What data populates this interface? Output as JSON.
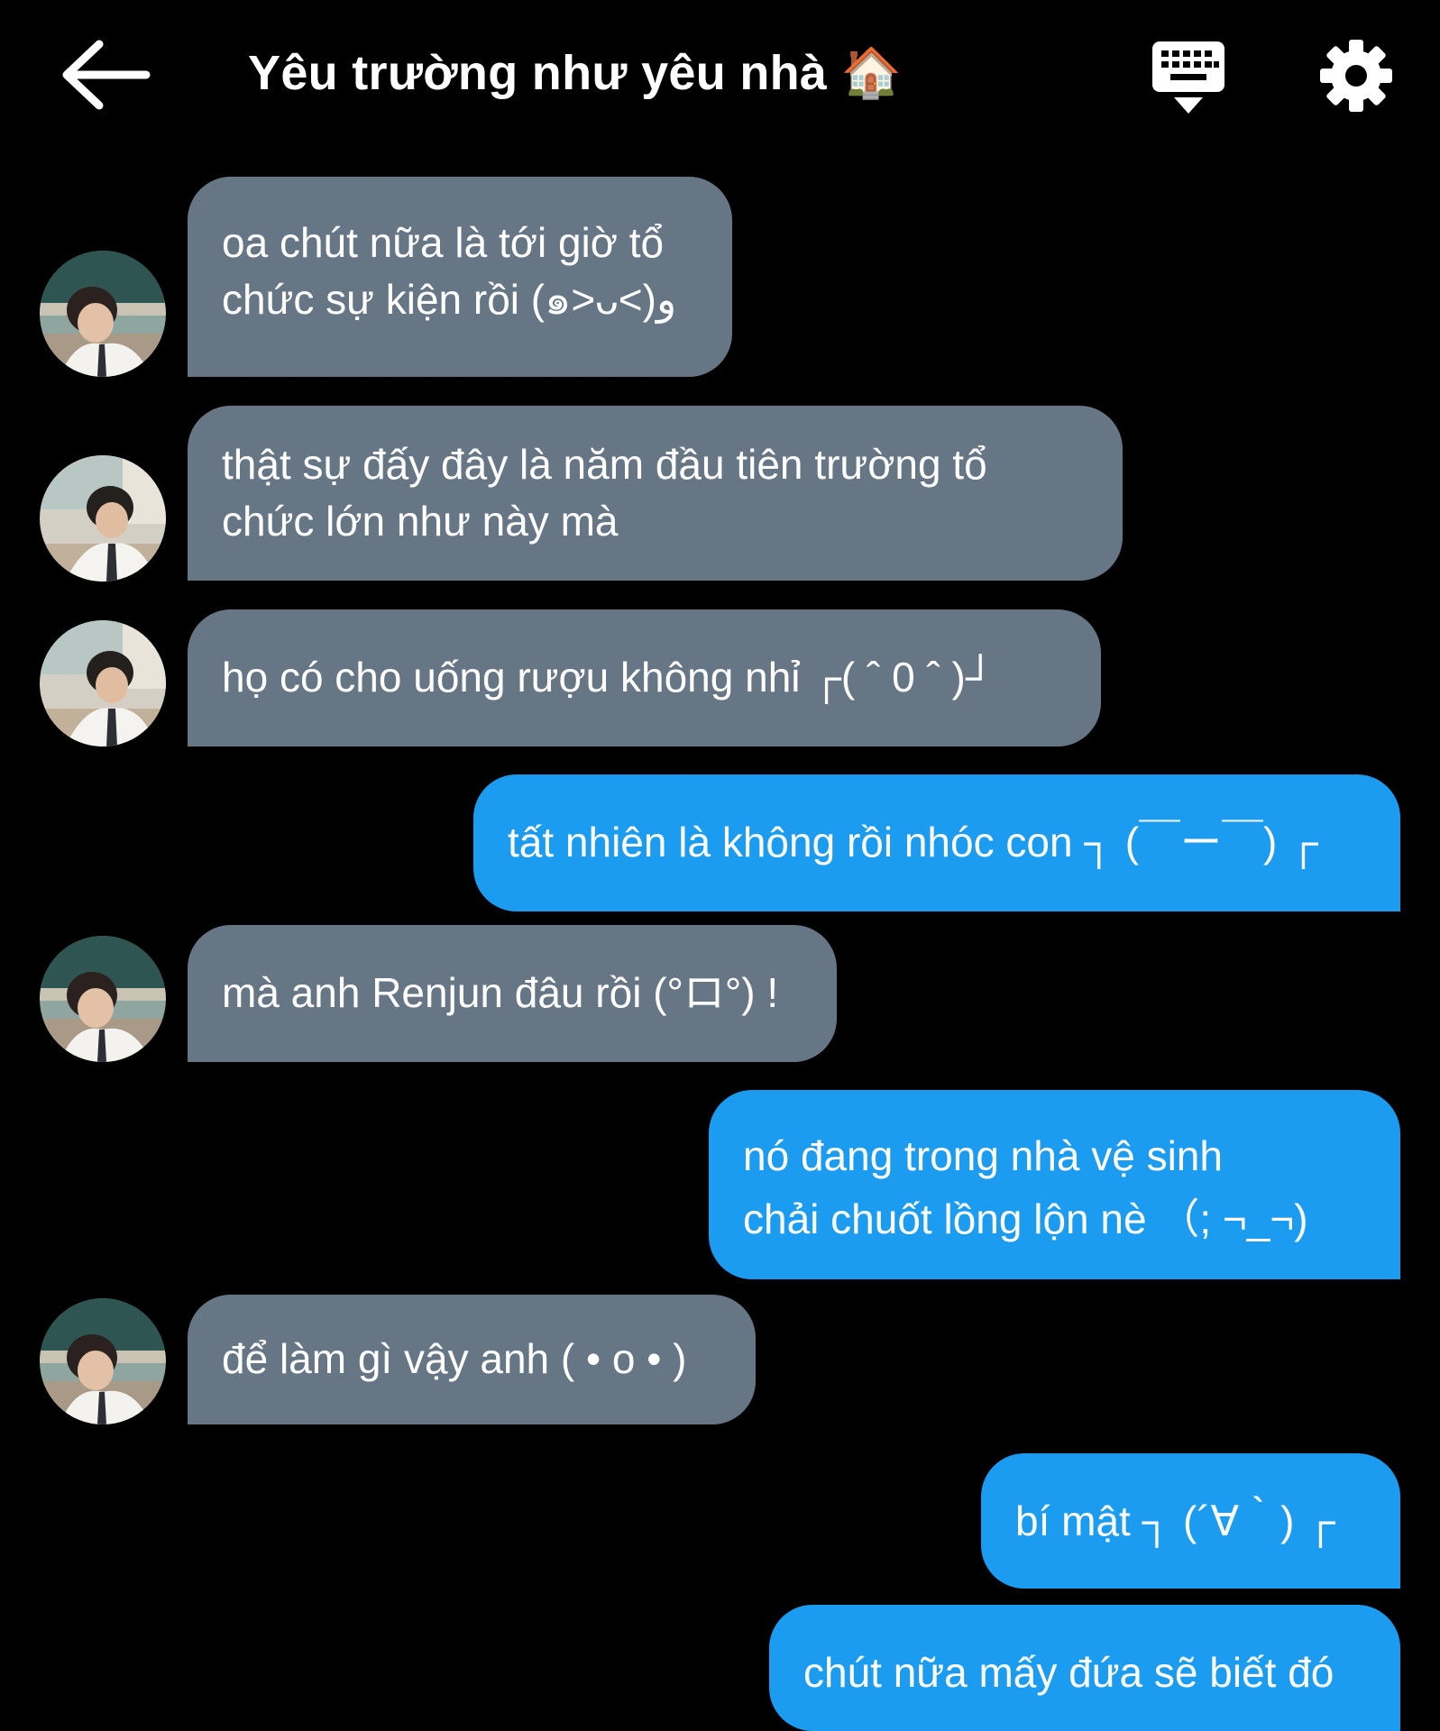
{
  "header": {
    "title": "Yêu trường như yêu nhà",
    "title_emoji": "🏠",
    "back_icon": "arrow-left-icon",
    "keyboard_icon": "keyboard-hide-icon",
    "settings_icon": "gear-icon"
  },
  "colors": {
    "background": "#000000",
    "incoming_bubble": "#677685",
    "outgoing_bubble": "#1c9cf0",
    "text": "#ffffff"
  },
  "messages": [
    {
      "side": "incoming",
      "lines": [
        "oa chút nữa là tới giờ tổ",
        "chức sự kiện rồi (๑˃ᴗ˂)ﻭ"
      ]
    },
    {
      "side": "incoming",
      "lines": [
        "thật sự đấy đây là năm đầu tiên trường tổ",
        "chức lớn như này mà"
      ]
    },
    {
      "side": "incoming",
      "lines": [
        "họ có cho uống rượu không nhỉ  ┌( ˆ 0 ˆ )┘"
      ]
    },
    {
      "side": "outgoing",
      "lines": [
        "tất nhiên là không rồi nhóc con ┐ (￣ー￣) ┌"
      ]
    },
    {
      "side": "incoming",
      "lines": [
        "mà anh Renjun đâu rồi (°ロ°) !"
      ]
    },
    {
      "side": "outgoing",
      "lines": [
        "nó đang trong nhà vệ sinh",
        "chải chuốt lồng lộn nè （; ¬_¬)"
      ]
    },
    {
      "side": "incoming",
      "lines": [
        "để làm gì vậy anh ( • o • )"
      ]
    },
    {
      "side": "outgoing",
      "lines": [
        "bí mật ┐ (´∀｀) ┌"
      ]
    },
    {
      "side": "outgoing",
      "lines": [
        "chút nữa mấy đứa sẽ biết đó"
      ]
    }
  ]
}
